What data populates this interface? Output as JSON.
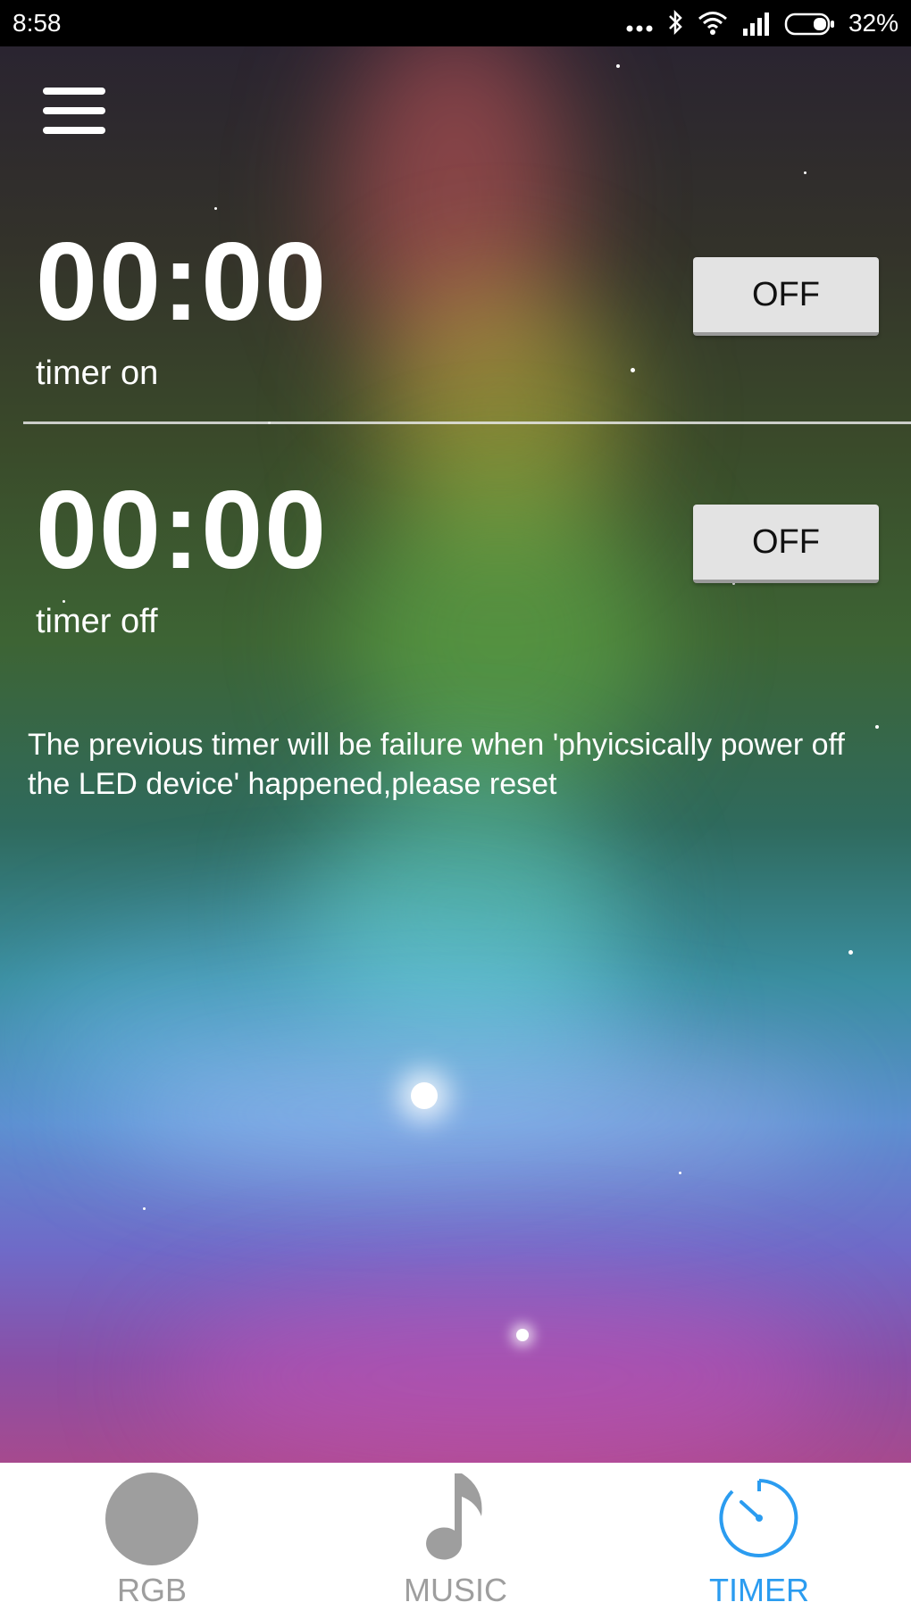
{
  "status_bar": {
    "time": "8:58",
    "battery_percent": "32%",
    "icons": [
      "more-dots-icon",
      "bluetooth-icon",
      "wifi-icon",
      "signal-icon",
      "battery-icon"
    ]
  },
  "header": {
    "menu_icon": "hamburger-menu-icon"
  },
  "timers": [
    {
      "time": "00:00",
      "label": "timer on",
      "button_label": "OFF"
    },
    {
      "time": "00:00",
      "label": "timer off",
      "button_label": "OFF"
    }
  ],
  "notice": "The previous timer will be failure when 'phyicsically power off the LED device' happened,please reset",
  "bottom_nav": {
    "items": [
      {
        "label": "RGB",
        "icon": "rgb-circle-icon",
        "active": false
      },
      {
        "label": "MUSIC",
        "icon": "music-note-icon",
        "active": false
      },
      {
        "label": "TIMER",
        "icon": "timer-icon",
        "active": true
      }
    ],
    "active_color": "#2b9cf0",
    "inactive_color": "#9e9e9e"
  },
  "colors": {
    "status_bar_bg": "#000000",
    "button_bg": "#e3e3e3",
    "text": "#ffffff"
  }
}
